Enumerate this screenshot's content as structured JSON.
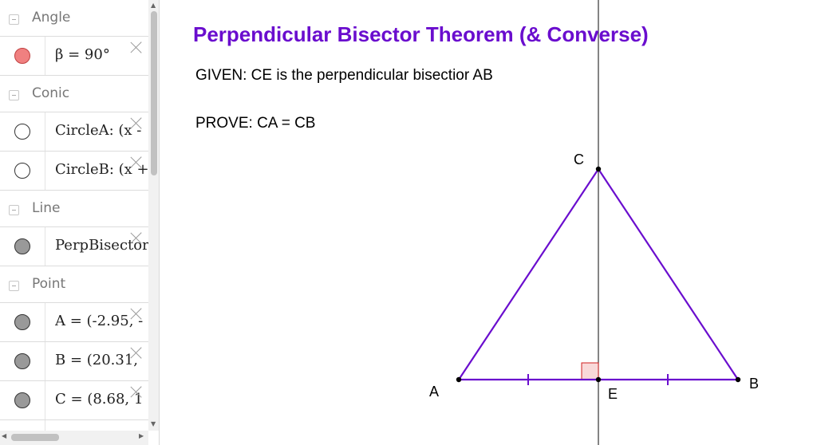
{
  "algebra": {
    "groups": [
      {
        "label": "Angle"
      },
      {
        "label": "Conic"
      },
      {
        "label": "Line"
      },
      {
        "label": "Point"
      }
    ],
    "rows": [
      {
        "expr": "β = 90°",
        "marker_color": "#f08080"
      },
      {
        "expr": "CircleA: (x -",
        "marker_color": "#ffffff"
      },
      {
        "expr": "CircleB: (x +",
        "marker_color": "#ffffff"
      },
      {
        "expr": "PerpBisector",
        "marker_color": "#999999"
      },
      {
        "expr": "A = (-2.95, -",
        "marker_color": "#999999"
      },
      {
        "expr": "B = (20.31,",
        "marker_color": "#999999"
      },
      {
        "expr": "C = (8.68, 1",
        "marker_color": "#999999"
      }
    ]
  },
  "graphics": {
    "title": "Perpendicular Bisector Theorem (& Converse)",
    "given": "GIVEN:  CE is the perpendicular bisectior AB",
    "prove": "PROVE:  CA = CB",
    "points": {
      "A": "A",
      "B": "B",
      "C": "C",
      "E": "E"
    },
    "colors": {
      "triangle": "#6a0dce",
      "title": "#6a0dce",
      "right_angle": "#d02020",
      "line": "#333333"
    }
  }
}
